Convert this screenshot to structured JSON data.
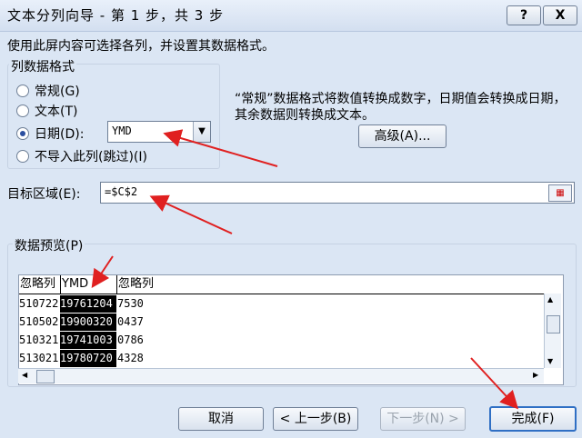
{
  "window": {
    "title": "文本分列向导 - 第 1 步，共 3 步",
    "help": "?",
    "close": "X"
  },
  "instruction": "使用此屏内容可选择各列，并设置其数据格式。",
  "format_group": {
    "title": "列数据格式",
    "options": [
      {
        "label": "常规(G)",
        "selected": false
      },
      {
        "label": "文本(T)",
        "selected": false
      },
      {
        "label": "日期(D):",
        "selected": true
      },
      {
        "label": "不导入此列(跳过)(I)",
        "selected": false
      }
    ],
    "date_format": "YMD",
    "description": "“常规”数据格式将数值转换成数字，日期值会转换成日期，其余数据则转换成文本。",
    "advanced_button": "高级(A)..."
  },
  "destination": {
    "label": "目标区域(E):",
    "value": "=$C$2"
  },
  "preview": {
    "label": "数据预览(P)",
    "headers": [
      "忽略列",
      "YMD",
      "忽略列"
    ],
    "rows": [
      [
        "510722",
        "19761204",
        "7530"
      ],
      [
        "510502",
        "19900320",
        "0437"
      ],
      [
        "510321",
        "19741003",
        "0786"
      ],
      [
        "513021",
        "19780720",
        "4328"
      ]
    ]
  },
  "buttons": {
    "cancel": "取消",
    "back": "< 上一步(B)",
    "next": "下一步(N) >",
    "finish": "完成(F)"
  },
  "colors": {
    "arrow": "#e02020",
    "selected_column": "#000000"
  }
}
